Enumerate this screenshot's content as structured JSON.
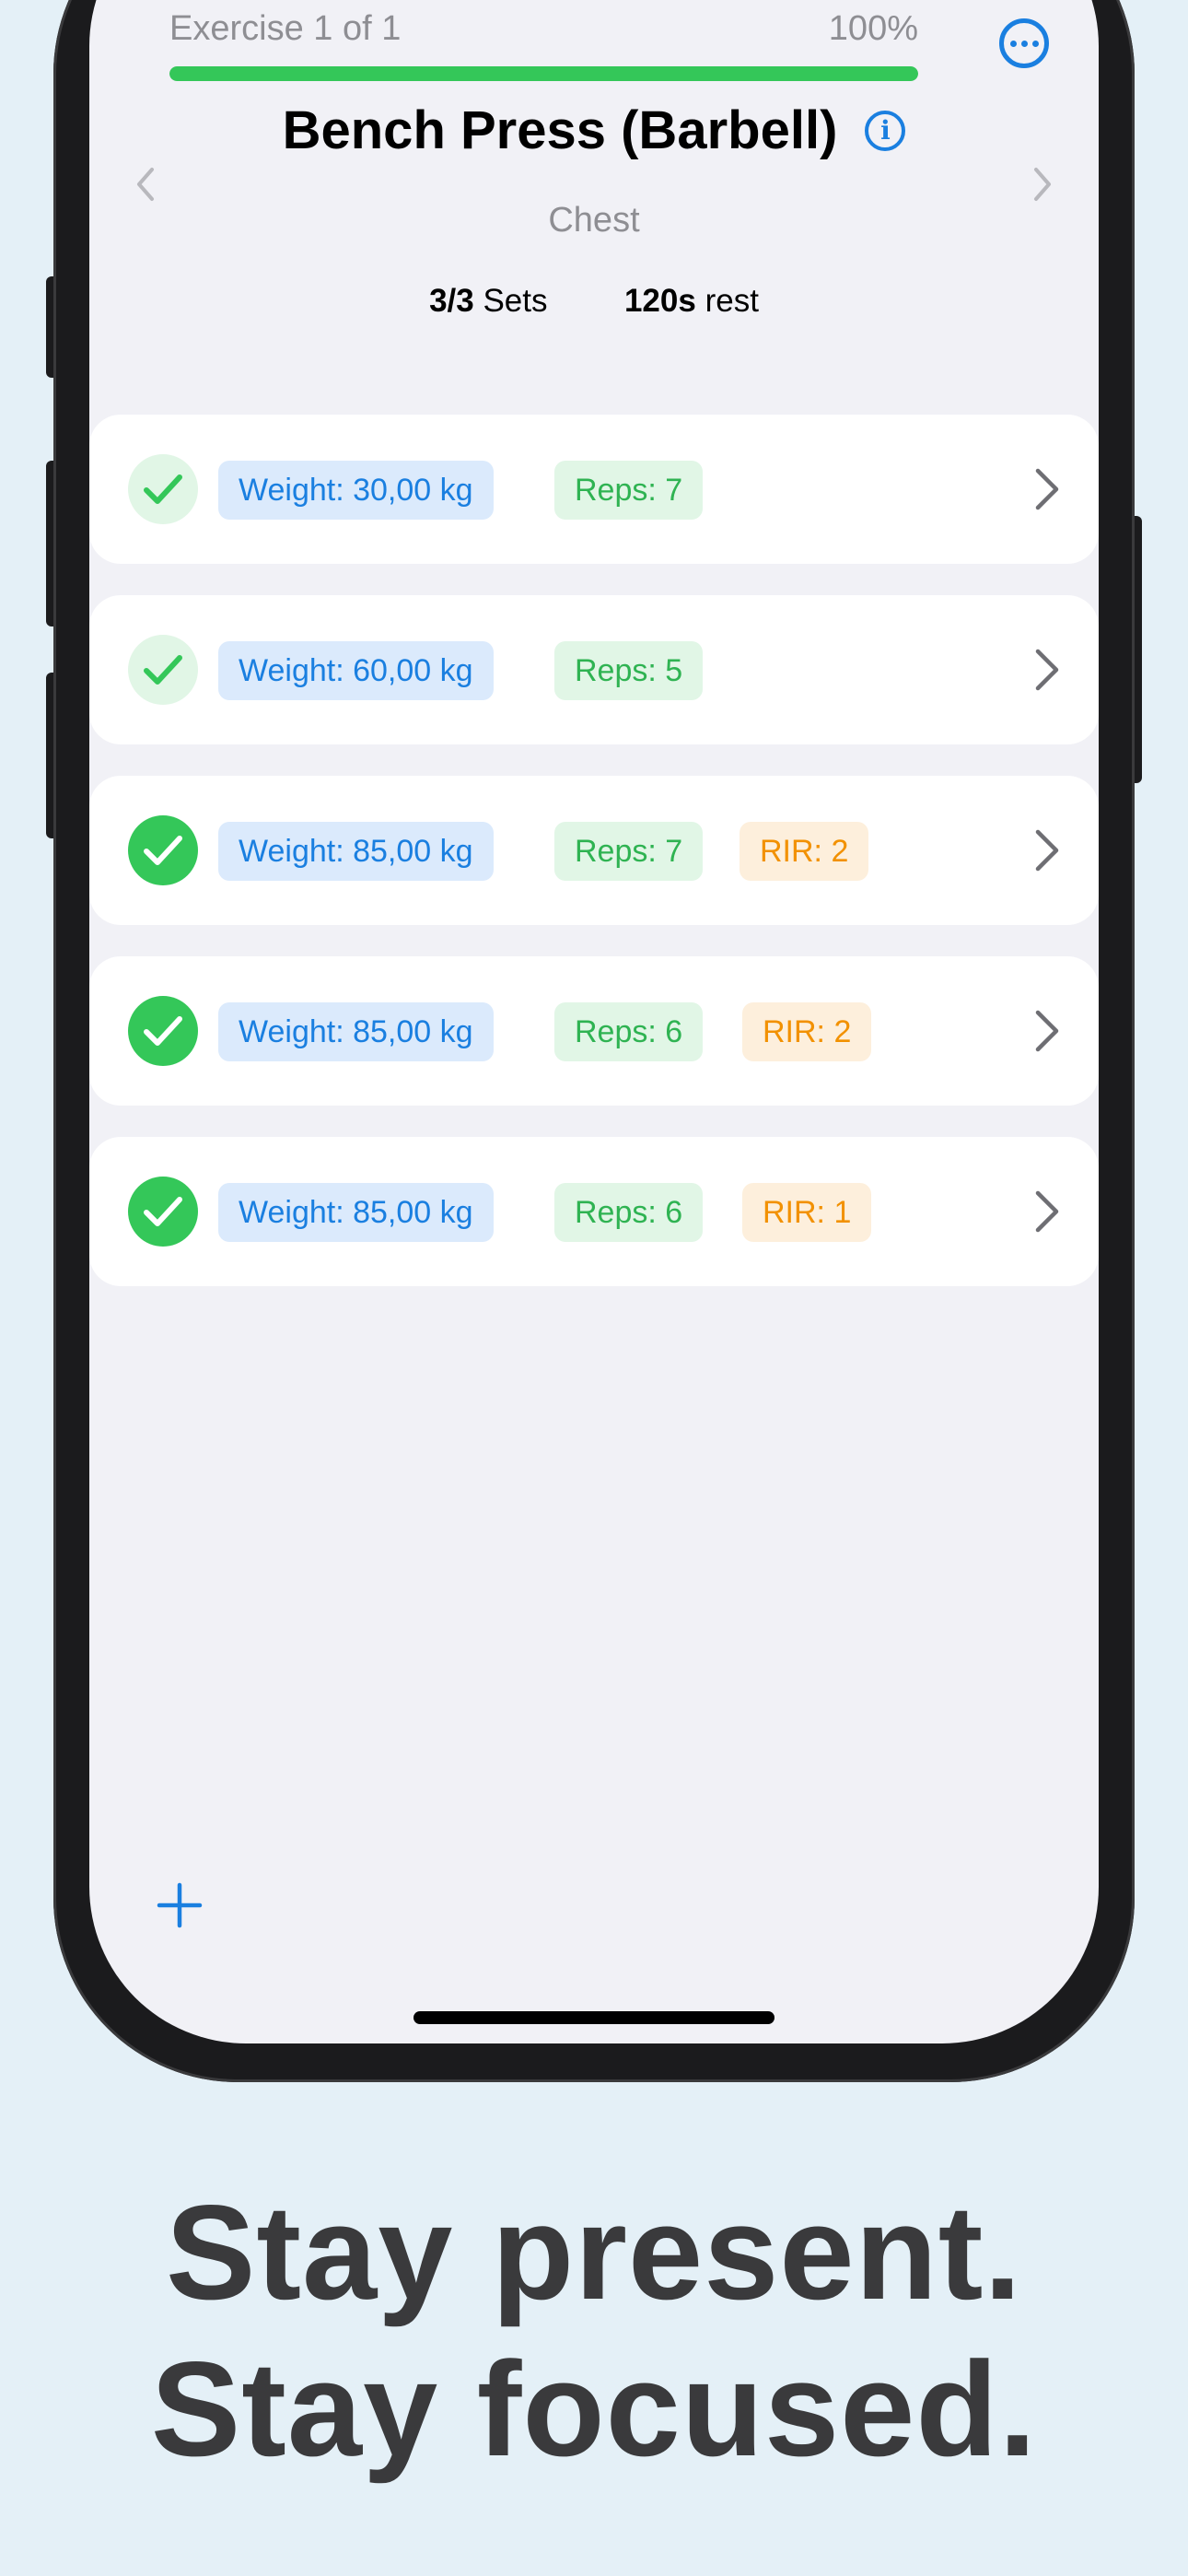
{
  "header": {
    "progress_label": "Exercise 1 of 1",
    "progress_percent_label": "100%",
    "progress_fraction": 1.0,
    "more_icon": "ellipsis-circle-icon"
  },
  "exercise": {
    "title": "Bench Press (Barbell)",
    "info_icon": "info-circle-icon",
    "muscle_group": "Chest",
    "sets_count": "3/3",
    "sets_label": "Sets",
    "rest_value": "120s",
    "rest_label": "rest"
  },
  "sets": [
    {
      "status": "warmup-done",
      "weight": "Weight: 30,00 kg",
      "reps": "Reps: 7",
      "rir": null
    },
    {
      "status": "warmup-done",
      "weight": "Weight: 60,00 kg",
      "reps": "Reps: 5",
      "rir": null
    },
    {
      "status": "done",
      "weight": "Weight: 85,00 kg",
      "reps": "Reps: 7",
      "rir": "RIR: 2"
    },
    {
      "status": "done",
      "weight": "Weight: 85,00 kg",
      "reps": "Reps: 6",
      "rir": "RIR: 2"
    },
    {
      "status": "done",
      "weight": "Weight: 85,00 kg",
      "reps": "Reps: 6",
      "rir": "RIR: 1"
    }
  ],
  "toolbar": {
    "add_icon": "plus-icon"
  },
  "marketing": {
    "line1": "Stay present.",
    "line2": "Stay focused."
  },
  "colors": {
    "accent": "#1a7fe0",
    "success": "#34c759",
    "warning": "#f29100",
    "background": "#e4f0f7"
  }
}
